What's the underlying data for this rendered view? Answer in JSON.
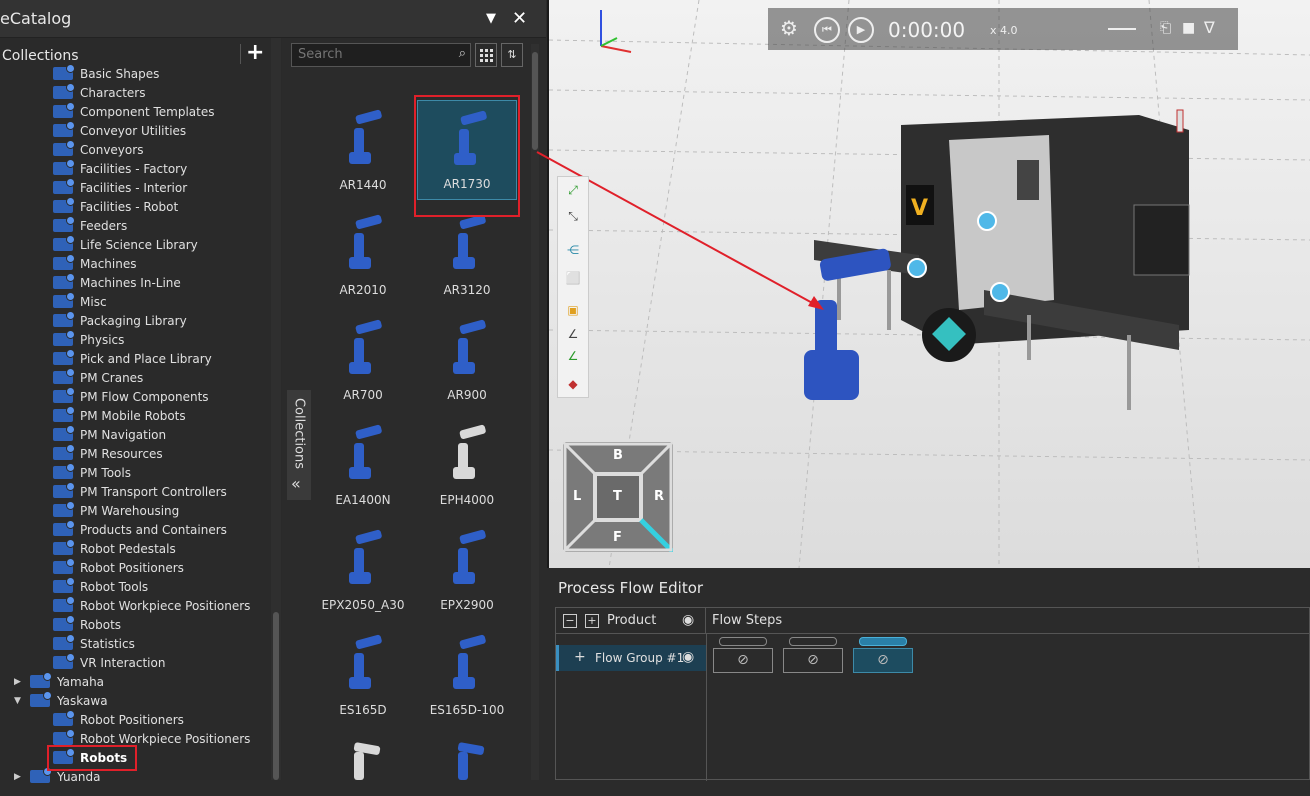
{
  "catalog": {
    "title": "eCatalog",
    "collections_label": "Collections",
    "search_placeholder": "Search",
    "side_tab_label": "Collections",
    "tree": [
      {
        "label": "Basic Shapes"
      },
      {
        "label": "Characters"
      },
      {
        "label": "Component Templates"
      },
      {
        "label": "Conveyor Utilities"
      },
      {
        "label": "Conveyors"
      },
      {
        "label": "Facilities - Factory"
      },
      {
        "label": "Facilities - Interior"
      },
      {
        "label": "Facilities - Robot"
      },
      {
        "label": "Feeders"
      },
      {
        "label": "Life Science Library"
      },
      {
        "label": "Machines"
      },
      {
        "label": "Machines In-Line"
      },
      {
        "label": "Misc"
      },
      {
        "label": "Packaging Library"
      },
      {
        "label": "Physics"
      },
      {
        "label": "Pick and Place Library"
      },
      {
        "label": "PM Cranes"
      },
      {
        "label": "PM Flow Components"
      },
      {
        "label": "PM Mobile Robots"
      },
      {
        "label": "PM Navigation"
      },
      {
        "label": "PM Resources"
      },
      {
        "label": "PM Tools"
      },
      {
        "label": "PM Transport Controllers"
      },
      {
        "label": "PM Warehousing"
      },
      {
        "label": "Products and Containers"
      },
      {
        "label": "Robot Pedestals"
      },
      {
        "label": "Robot Positioners"
      },
      {
        "label": "Robot Tools"
      },
      {
        "label": "Robot Workpiece Positioners"
      },
      {
        "label": "Robots"
      },
      {
        "label": "Statistics"
      },
      {
        "label": "VR Interaction"
      }
    ],
    "vendors": [
      {
        "label": "Yamaha",
        "expanded": false
      },
      {
        "label": "Yaskawa",
        "expanded": true
      },
      {
        "label": "Yuanda",
        "expanded": false
      }
    ],
    "yaskawa_children": [
      {
        "label": "Robot Positioners"
      },
      {
        "label": "Robot Workpiece Positioners"
      },
      {
        "label": "Robots",
        "selected": true
      }
    ],
    "items": [
      {
        "label": "AR1440"
      },
      {
        "label": "AR1730",
        "selected": true
      },
      {
        "label": "AR2010"
      },
      {
        "label": "AR3120"
      },
      {
        "label": "AR700"
      },
      {
        "label": "AR900"
      },
      {
        "label": "EA1400N"
      },
      {
        "label": "EPH4000"
      },
      {
        "label": "EPX2050_A30"
      },
      {
        "label": "EPX2900"
      },
      {
        "label": "ES165D"
      },
      {
        "label": "ES165D-100"
      }
    ]
  },
  "simulation": {
    "time": "0:00:00",
    "speed": "x 4.0"
  },
  "nav_cube": {
    "top": "B",
    "left": "L",
    "center": "T",
    "right": "R",
    "bottom": "F"
  },
  "flow_editor": {
    "title": "Process Flow Editor",
    "product_header": "Product",
    "flow_steps_header": "Flow Steps",
    "flow_group": "Flow Group #1"
  },
  "colors": {
    "accent": "#2f62b8",
    "selection": "#1e4c5e",
    "highlight_box": "#e0202a",
    "teal": "#35d0e0"
  }
}
